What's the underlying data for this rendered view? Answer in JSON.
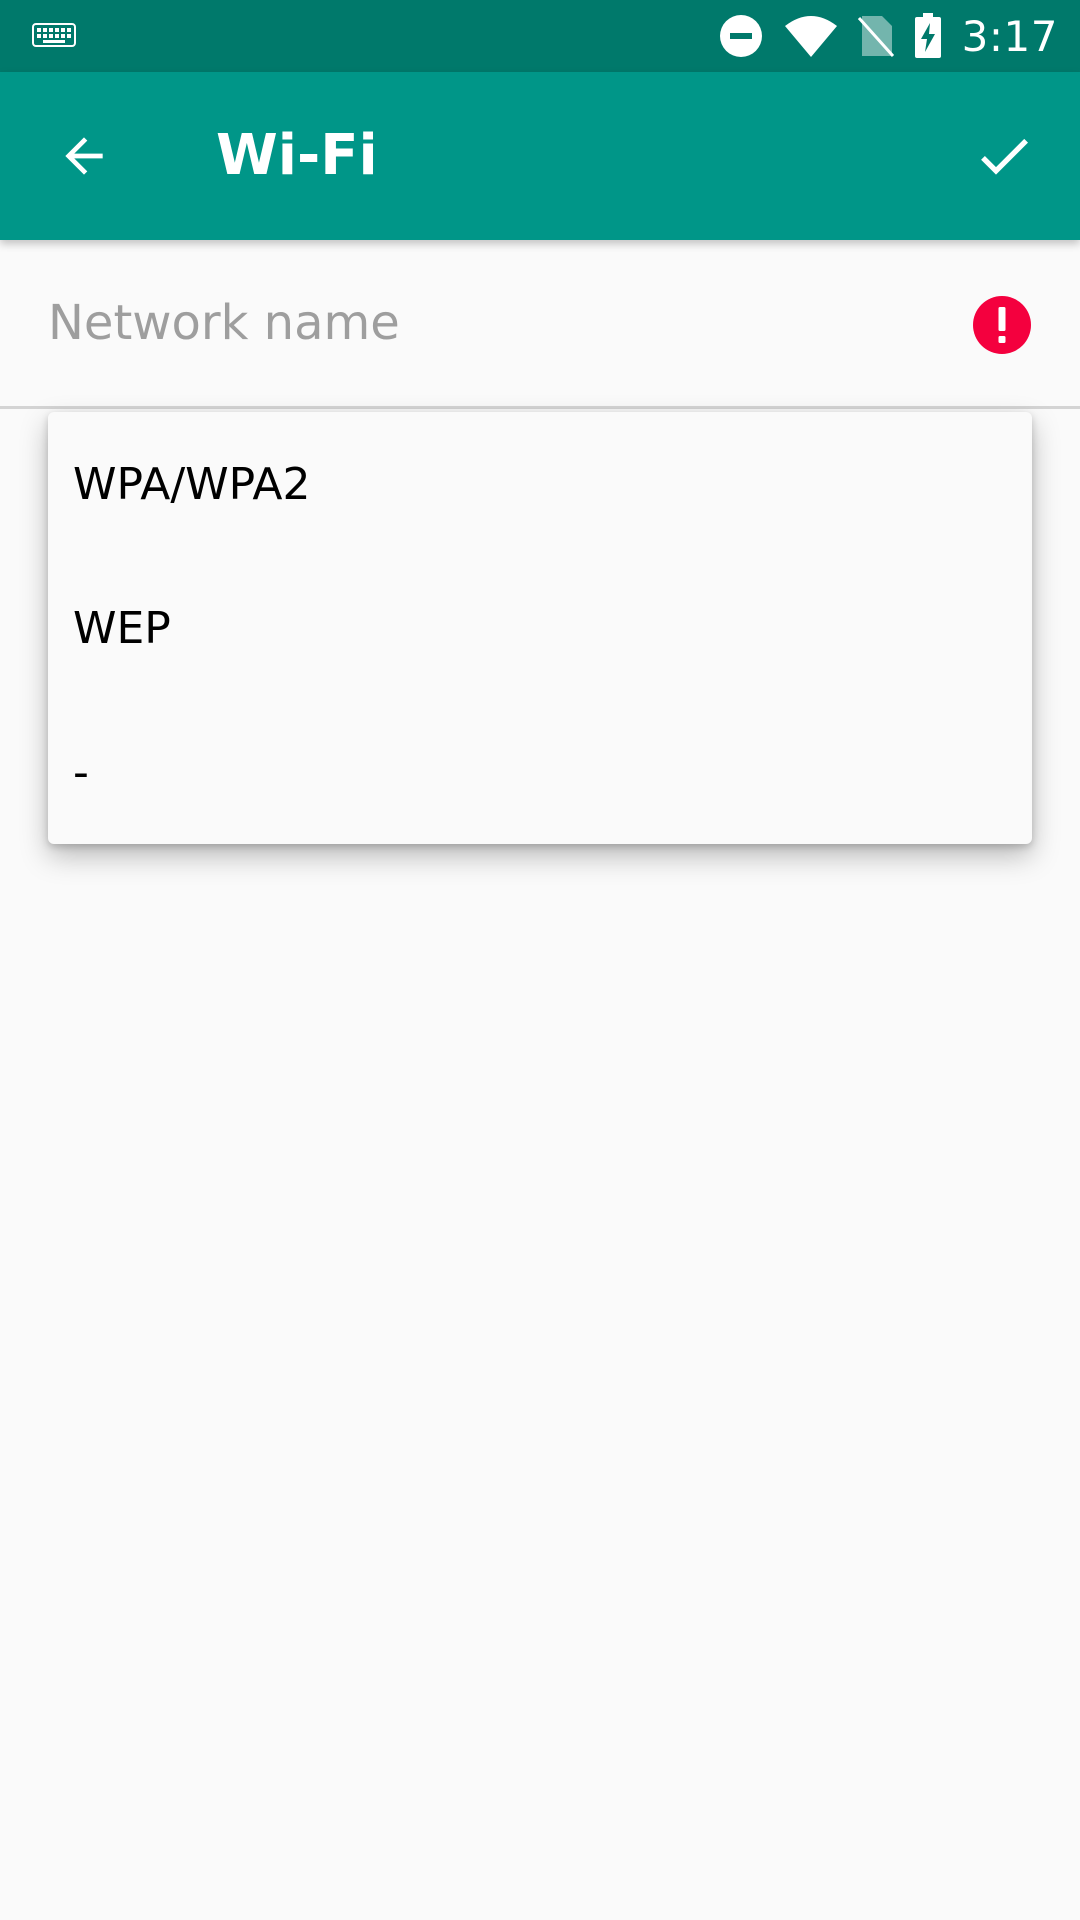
{
  "status_bar": {
    "time": "3:17",
    "icons": [
      "keyboard-icon",
      "do-not-disturb-icon",
      "wifi-icon",
      "no-sim-icon",
      "battery-charging-icon"
    ]
  },
  "toolbar": {
    "title": "Wi-Fi",
    "back_icon": "arrow-back-icon",
    "done_icon": "check-icon",
    "color": "#009688",
    "status_color": "#00796b"
  },
  "network_form": {
    "ssid_value": "",
    "ssid_placeholder": "Network name",
    "error_icon": "error-icon",
    "error_color": "#f4003e"
  },
  "security_dropdown": {
    "options": [
      "WPA/WPA2",
      "WEP",
      "-"
    ]
  }
}
